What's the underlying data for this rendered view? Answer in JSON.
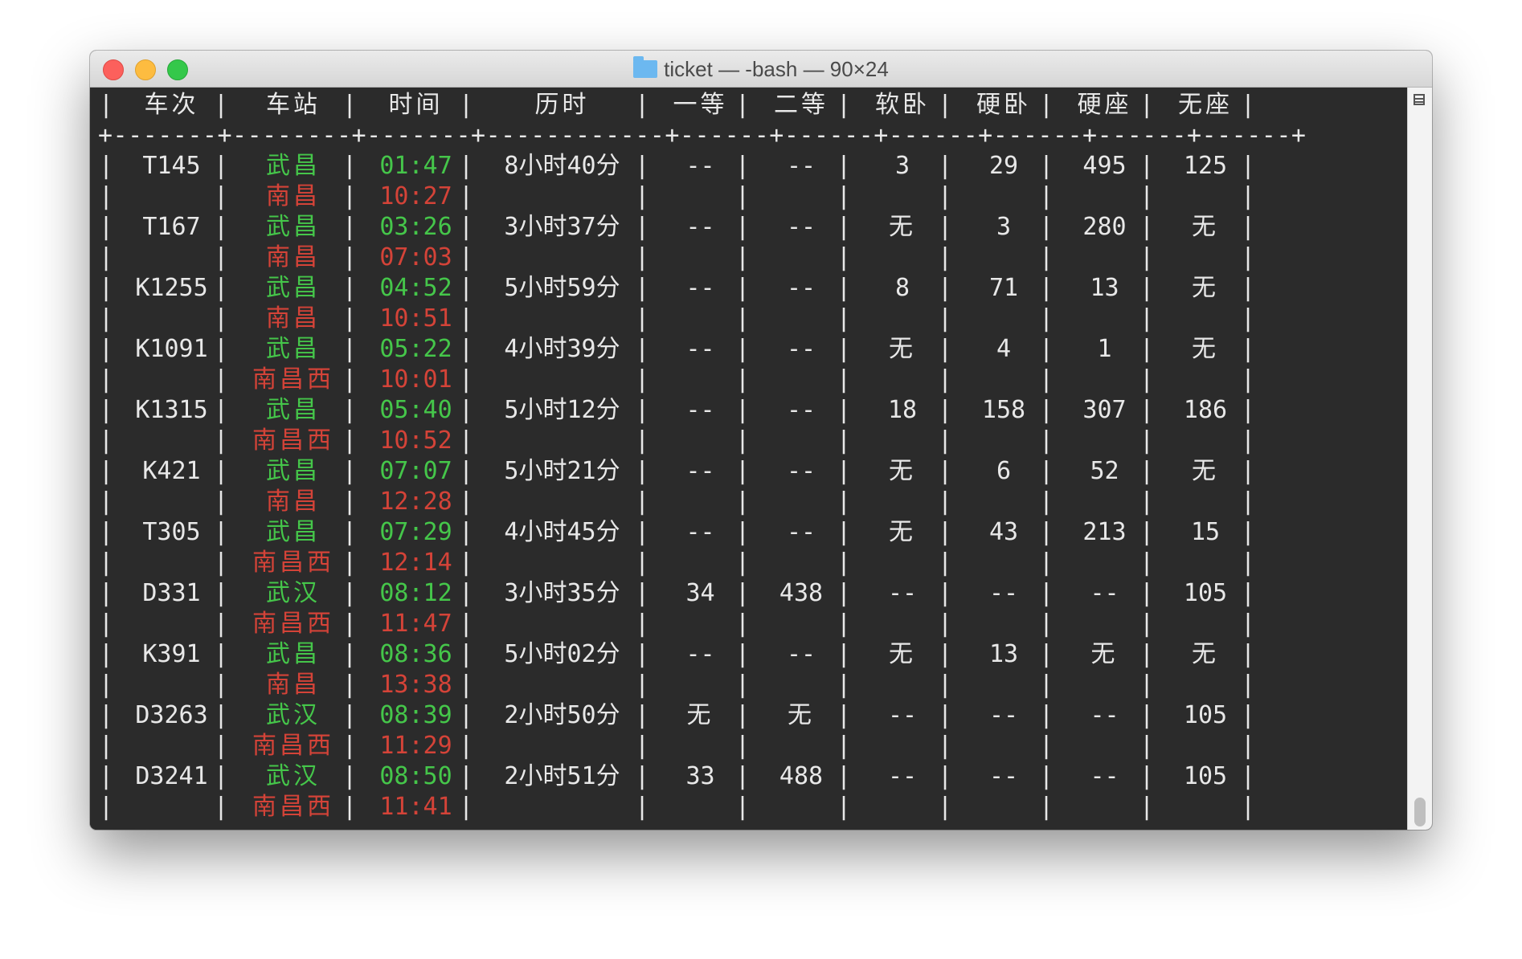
{
  "window": {
    "title": "ticket — -bash — 90×24",
    "folder_icon": "folder-icon"
  },
  "table": {
    "headers": [
      "车次",
      "车站",
      "时间",
      "历时",
      "一等",
      "二等",
      "软卧",
      "硬卧",
      "硬座",
      "无座"
    ],
    "separator": "+-------+--------+-------+------------+------+------+------+------+------+------+",
    "colors": {
      "departure": "#45c64a",
      "arrival": "#d44338",
      "text": "#e8e8e8",
      "background": "#2b2b2b"
    },
    "trains": [
      {
        "train": "T145",
        "from": "武昌",
        "to": "南昌",
        "depart": "01:47",
        "arrive": "10:27",
        "duration": "8小时40分",
        "first": "--",
        "second": "--",
        "soft_sleeper": "3",
        "hard_sleeper": "29",
        "hard_seat": "495",
        "no_seat": "125"
      },
      {
        "train": "T167",
        "from": "武昌",
        "to": "南昌",
        "depart": "03:26",
        "arrive": "07:03",
        "duration": "3小时37分",
        "first": "--",
        "second": "--",
        "soft_sleeper": "无",
        "hard_sleeper": "3",
        "hard_seat": "280",
        "no_seat": "无"
      },
      {
        "train": "K1255",
        "from": "武昌",
        "to": "南昌",
        "depart": "04:52",
        "arrive": "10:51",
        "duration": "5小时59分",
        "first": "--",
        "second": "--",
        "soft_sleeper": "8",
        "hard_sleeper": "71",
        "hard_seat": "13",
        "no_seat": "无"
      },
      {
        "train": "K1091",
        "from": "武昌",
        "to": "南昌西",
        "depart": "05:22",
        "arrive": "10:01",
        "duration": "4小时39分",
        "first": "--",
        "second": "--",
        "soft_sleeper": "无",
        "hard_sleeper": "4",
        "hard_seat": "1",
        "no_seat": "无"
      },
      {
        "train": "K1315",
        "from": "武昌",
        "to": "南昌西",
        "depart": "05:40",
        "arrive": "10:52",
        "duration": "5小时12分",
        "first": "--",
        "second": "--",
        "soft_sleeper": "18",
        "hard_sleeper": "158",
        "hard_seat": "307",
        "no_seat": "186"
      },
      {
        "train": "K421",
        "from": "武昌",
        "to": "南昌",
        "depart": "07:07",
        "arrive": "12:28",
        "duration": "5小时21分",
        "first": "--",
        "second": "--",
        "soft_sleeper": "无",
        "hard_sleeper": "6",
        "hard_seat": "52",
        "no_seat": "无"
      },
      {
        "train": "T305",
        "from": "武昌",
        "to": "南昌西",
        "depart": "07:29",
        "arrive": "12:14",
        "duration": "4小时45分",
        "first": "--",
        "second": "--",
        "soft_sleeper": "无",
        "hard_sleeper": "43",
        "hard_seat": "213",
        "no_seat": "15"
      },
      {
        "train": "D331",
        "from": "武汉",
        "to": "南昌西",
        "depart": "08:12",
        "arrive": "11:47",
        "duration": "3小时35分",
        "first": "34",
        "second": "438",
        "soft_sleeper": "--",
        "hard_sleeper": "--",
        "hard_seat": "--",
        "no_seat": "105"
      },
      {
        "train": "K391",
        "from": "武昌",
        "to": "南昌",
        "depart": "08:36",
        "arrive": "13:38",
        "duration": "5小时02分",
        "first": "--",
        "second": "--",
        "soft_sleeper": "无",
        "hard_sleeper": "13",
        "hard_seat": "无",
        "no_seat": "无"
      },
      {
        "train": "D3263",
        "from": "武汉",
        "to": "南昌西",
        "depart": "08:39",
        "arrive": "11:29",
        "duration": "2小时50分",
        "first": "无",
        "second": "无",
        "soft_sleeper": "--",
        "hard_sleeper": "--",
        "hard_seat": "--",
        "no_seat": "105"
      },
      {
        "train": "D3241",
        "from": "武汉",
        "to": "南昌西",
        "depart": "08:50",
        "arrive": "11:41",
        "duration": "2小时51分",
        "first": "33",
        "second": "488",
        "soft_sleeper": "--",
        "hard_sleeper": "--",
        "hard_seat": "--",
        "no_seat": "105"
      }
    ]
  }
}
